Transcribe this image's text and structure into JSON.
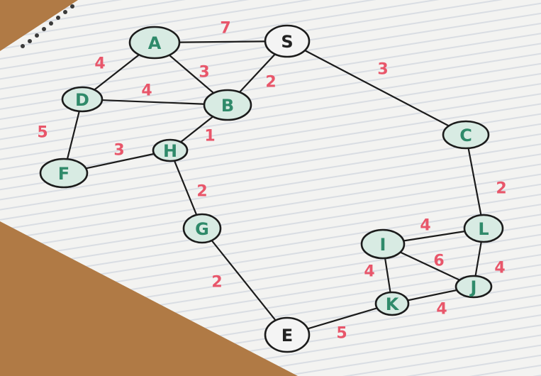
{
  "graph": {
    "colors": {
      "node_fill": "#2f8a6a",
      "node_fill_plain": "#f4f4f4",
      "node_label": "#2f8a6a",
      "node_label_plain": "#222222",
      "edge": "#1b1b1b",
      "weight": "#e8566a",
      "paper": "#f3f3f1",
      "paper_lines": "#d9dde3",
      "table": "#b07a45"
    },
    "nodes": [
      {
        "id": "S",
        "label": "S",
        "style": "plain"
      },
      {
        "id": "A",
        "label": "A",
        "style": "green"
      },
      {
        "id": "B",
        "label": "B",
        "style": "green"
      },
      {
        "id": "D",
        "label": "D",
        "style": "green"
      },
      {
        "id": "F",
        "label": "F",
        "style": "green"
      },
      {
        "id": "H",
        "label": "H",
        "style": "green"
      },
      {
        "id": "G",
        "label": "G",
        "style": "green"
      },
      {
        "id": "E",
        "label": "E",
        "style": "plain"
      },
      {
        "id": "C",
        "label": "C",
        "style": "green"
      },
      {
        "id": "L",
        "label": "L",
        "style": "green"
      },
      {
        "id": "I",
        "label": "I",
        "style": "green"
      },
      {
        "id": "J",
        "label": "J",
        "style": "green"
      },
      {
        "id": "K",
        "label": "K",
        "style": "green"
      }
    ],
    "edges": [
      {
        "from": "A",
        "to": "S",
        "weight": "7"
      },
      {
        "from": "S",
        "to": "B",
        "weight": "2"
      },
      {
        "from": "S",
        "to": "C",
        "weight": "3"
      },
      {
        "from": "A",
        "to": "D",
        "weight": "4"
      },
      {
        "from": "A",
        "to": "B",
        "weight": "3"
      },
      {
        "from": "D",
        "to": "B",
        "weight": "4"
      },
      {
        "from": "D",
        "to": "F",
        "weight": "5"
      },
      {
        "from": "B",
        "to": "H",
        "weight": "1"
      },
      {
        "from": "F",
        "to": "H",
        "weight": "3"
      },
      {
        "from": "H",
        "to": "G",
        "weight": "2"
      },
      {
        "from": "G",
        "to": "E",
        "weight": "2"
      },
      {
        "from": "C",
        "to": "L",
        "weight": "2"
      },
      {
        "from": "I",
        "to": "L",
        "weight": "4"
      },
      {
        "from": "L",
        "to": "J",
        "weight": "4"
      },
      {
        "from": "I",
        "to": "J",
        "weight": "6"
      },
      {
        "from": "I",
        "to": "K",
        "weight": "4"
      },
      {
        "from": "K",
        "to": "J",
        "weight": "4"
      },
      {
        "from": "E",
        "to": "K",
        "weight": "5"
      }
    ]
  }
}
